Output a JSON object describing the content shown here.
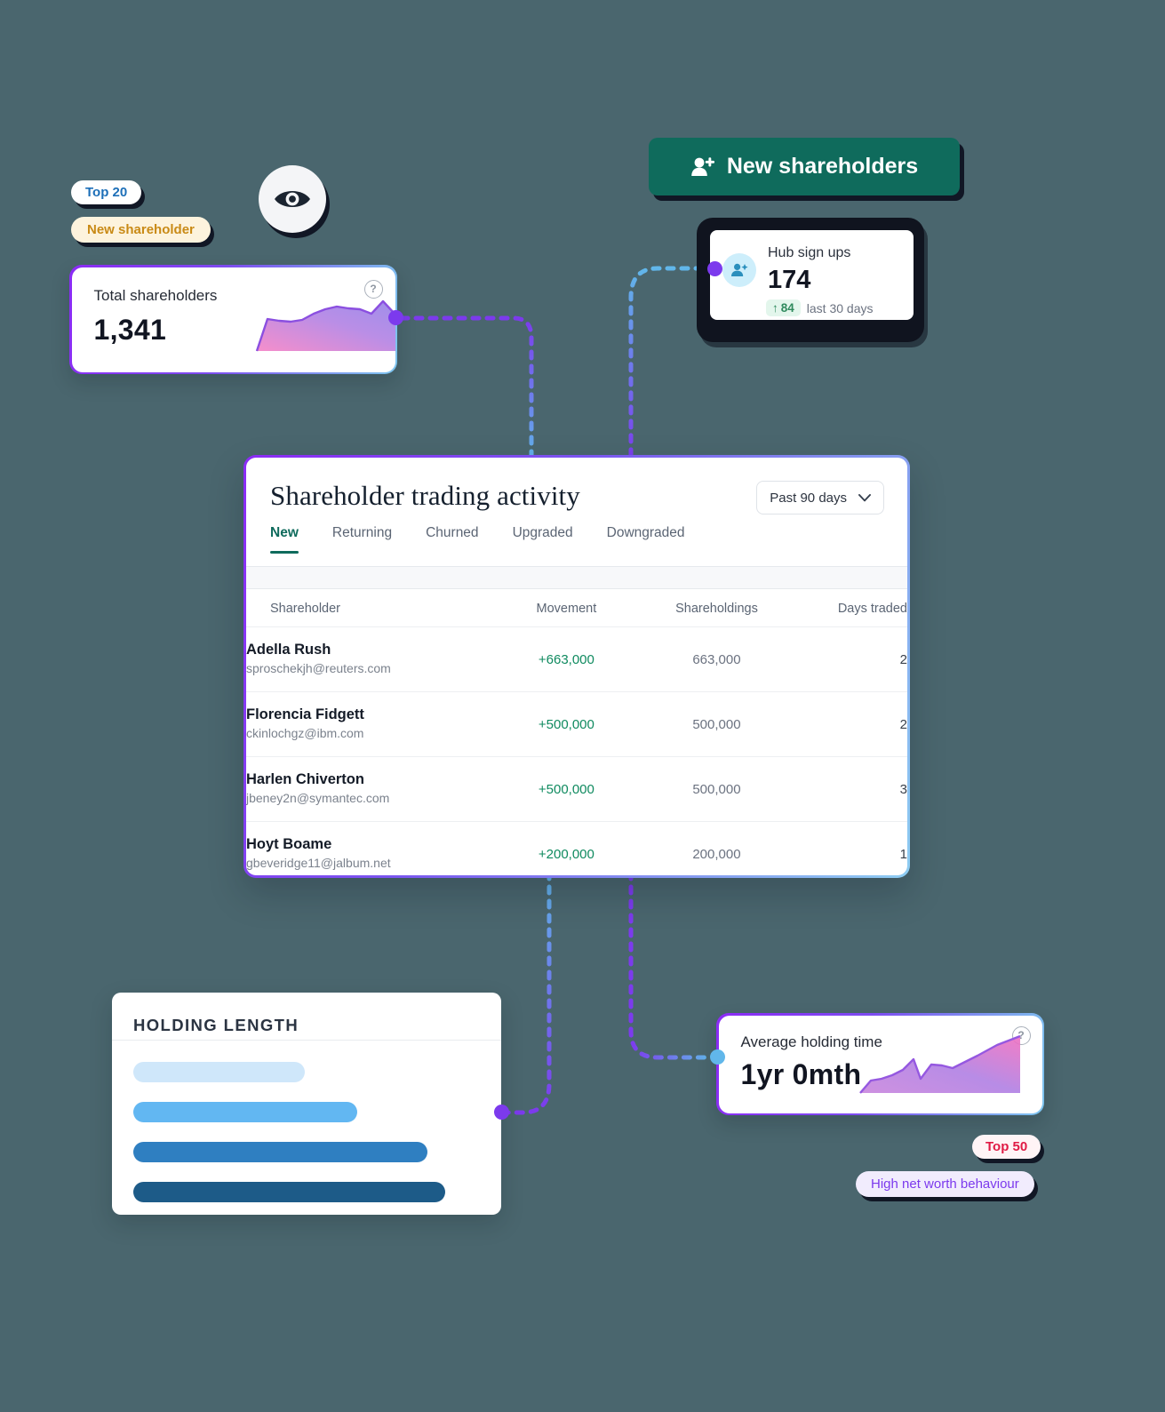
{
  "tags": {
    "top20": "Top 20",
    "new_shareholder": "New shareholder",
    "top50": "Top 50",
    "high_net_worth": "High net worth behaviour"
  },
  "button": {
    "new_shareholders_label": "New shareholders",
    "icon": "user-plus-icon",
    "color": "#0f6b5c"
  },
  "eye_badge": {
    "icon": "eye-icon"
  },
  "total_shareholders": {
    "label": "Total shareholders",
    "value": "1,341",
    "help_icon": "question-mark-icon"
  },
  "hub_signups": {
    "icon": "user-add-icon",
    "title": "Hub sign ups",
    "value": "174",
    "delta_arrow": "↑",
    "delta_value": "84",
    "delta_note": "last 30 days"
  },
  "trading": {
    "title": "Shareholder trading activity",
    "range_label": "Past 90 days",
    "range_icon": "chevron-down-icon",
    "tabs": [
      {
        "label": "New",
        "active": true
      },
      {
        "label": "Returning",
        "active": false
      },
      {
        "label": "Churned",
        "active": false
      },
      {
        "label": "Upgraded",
        "active": false
      },
      {
        "label": "Downgraded",
        "active": false
      }
    ],
    "columns": [
      "Shareholder",
      "Movement",
      "Shareholdings",
      "Days traded"
    ],
    "rows": [
      {
        "name": "Adella Rush",
        "email": "sproschekjh@reuters.com",
        "movement": "+663,000",
        "shareholdings": "663,000",
        "days": "2"
      },
      {
        "name": "Florencia Fidgett",
        "email": "ckinlochgz@ibm.com",
        "movement": "+500,000",
        "shareholdings": "500,000",
        "days": "2"
      },
      {
        "name": "Harlen Chiverton",
        "email": "jbeney2n@symantec.com",
        "movement": "+500,000",
        "shareholdings": "500,000",
        "days": "3"
      },
      {
        "name": "Hoyt Boame",
        "email": "gbeveridge11@jalbum.net",
        "movement": "+200,000",
        "shareholdings": "200,000",
        "days": "1"
      }
    ]
  },
  "holding_length": {
    "title": "HOLDING LENGTH",
    "bars": [
      {
        "width_pct": 49,
        "color": "#cfe7fa"
      },
      {
        "width_pct": 64,
        "color": "#62b7f2"
      },
      {
        "width_pct": 84,
        "color": "#2f7fc1"
      },
      {
        "width_pct": 89,
        "color": "#1d5b88"
      }
    ]
  },
  "avg_holding_time": {
    "label": "Average holding time",
    "value": "1yr 0mth",
    "help_icon": "question-mark-icon"
  },
  "chart_data": [
    {
      "type": "area",
      "title": "Total shareholders",
      "ylabel": "",
      "xlabel": "",
      "x": [
        0,
        1,
        2,
        3,
        4,
        5,
        6,
        7,
        8,
        9,
        10,
        11,
        12,
        13,
        14
      ],
      "values": [
        12,
        46,
        44,
        43,
        45,
        56,
        62,
        66,
        64,
        62,
        57,
        75,
        57,
        62,
        70
      ],
      "ylim": [
        0,
        80
      ]
    },
    {
      "type": "area",
      "title": "Average holding time",
      "ylabel": "",
      "xlabel": "",
      "x": [
        0,
        1,
        2,
        3,
        4,
        5,
        6,
        7,
        8,
        9,
        10,
        11,
        12,
        13
      ],
      "values": [
        10,
        18,
        20,
        26,
        36,
        52,
        31,
        48,
        46,
        43,
        50,
        60,
        76,
        90
      ],
      "ylim": [
        0,
        100
      ]
    },
    {
      "type": "bar",
      "title": "HOLDING LENGTH",
      "orientation": "horizontal",
      "categories": [
        "1",
        "2",
        "3",
        "4"
      ],
      "values": [
        49,
        64,
        84,
        89
      ],
      "xlabel": "",
      "ylabel": "",
      "xlim": [
        0,
        100
      ]
    }
  ]
}
